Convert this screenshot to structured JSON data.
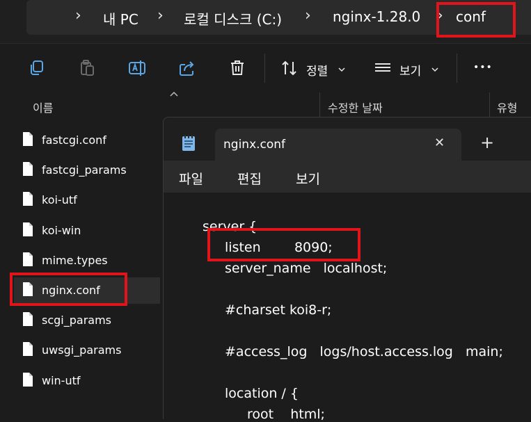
{
  "breadcrumb": {
    "items": [
      "내 PC",
      "로컬 디스크 (C:)",
      "nginx-1.28.0",
      "conf"
    ],
    "separator": "›"
  },
  "toolbar": {
    "sort_label": "정렬",
    "view_label": "보기",
    "more_label": "•••"
  },
  "columns": {
    "name": "이름",
    "modified": "수정한 날짜",
    "type": "유형"
  },
  "files": [
    {
      "name": "fastcgi.conf"
    },
    {
      "name": "fastcgi_params"
    },
    {
      "name": "koi-utf"
    },
    {
      "name": "koi-win"
    },
    {
      "name": "mime.types"
    },
    {
      "name": "nginx.conf",
      "selected": true
    },
    {
      "name": "scgi_params"
    },
    {
      "name": "uwsgi_params"
    },
    {
      "name": "win-utf"
    }
  ],
  "notepad": {
    "tab_title": "nginx.conf",
    "close_glyph": "✕",
    "new_tab_glyph": "+",
    "menu": [
      "파일",
      "편집",
      "보기"
    ],
    "lines": [
      "server {",
      "listen        8090;",
      "server_name   localhost;",
      "",
      "#charset koi8-r;",
      "",
      "#access_log   logs/host.access.log   main;",
      "",
      "location / {",
      "root    html;"
    ]
  },
  "colors": {
    "highlight": "#e0141a",
    "background": "#1c1c1c",
    "notepad_icon": "#7fb8e8"
  }
}
